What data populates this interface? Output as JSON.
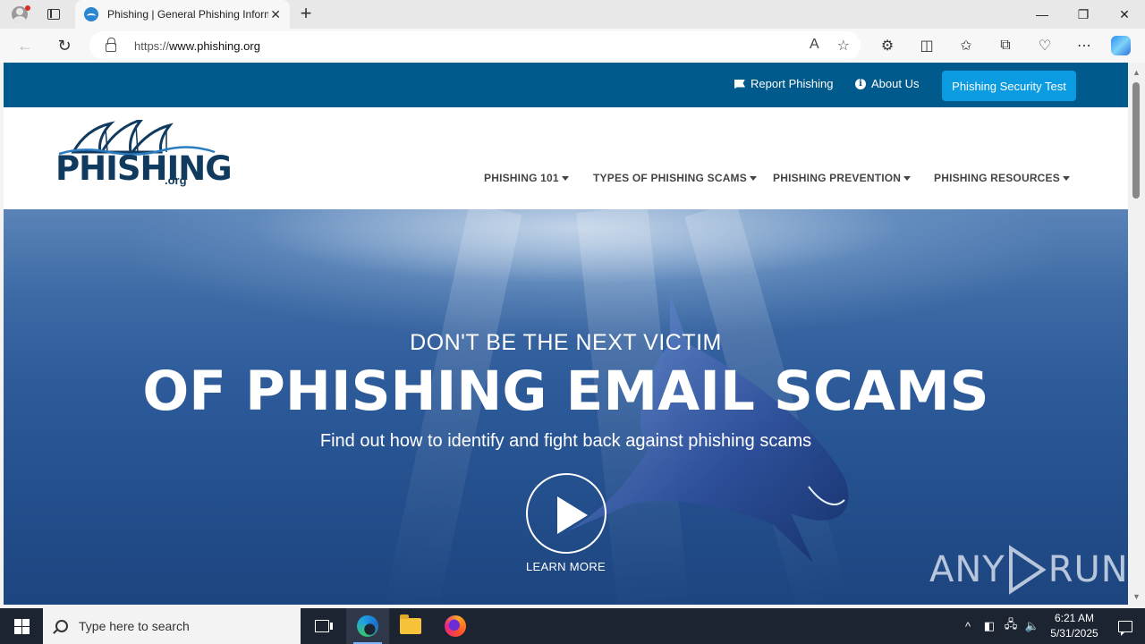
{
  "browser": {
    "tab_title": "Phishing | General Phishing Information",
    "tab_close": "✕",
    "new_tab": "+",
    "url_prefix": "https://",
    "url_host": "www.phishing.org",
    "window_controls": {
      "minimize": "—",
      "restore": "❐",
      "close": "✕"
    }
  },
  "site": {
    "topbar": {
      "report_label": "Report Phishing",
      "about_label": "About Us",
      "cta_label": "Phishing Security Test"
    },
    "logo": {
      "name": "PHISHING",
      "tld": ".org"
    },
    "nav": [
      {
        "label": "PHISHING 101"
      },
      {
        "label": "TYPES OF PHISHING SCAMS"
      },
      {
        "label": "PHISHING PREVENTION"
      },
      {
        "label": "PHISHING RESOURCES"
      }
    ],
    "hero": {
      "kicker": "DON'T BE THE NEXT VICTIM",
      "headline": "OF PHISHING EMAIL SCAMS",
      "subtext": "Find out how to identify and fight back against phishing scams",
      "learn_more": "LEARN MORE"
    },
    "watermark": {
      "left": "ANY",
      "right": "RUN"
    }
  },
  "taskbar": {
    "search_placeholder": "Type here to search",
    "time": "6:21 AM",
    "date": "5/31/2025"
  },
  "colors": {
    "topbar": "#005a8c",
    "cta": "#0a9be0",
    "logo": "#103b5e",
    "taskbar": "#1c2331"
  }
}
